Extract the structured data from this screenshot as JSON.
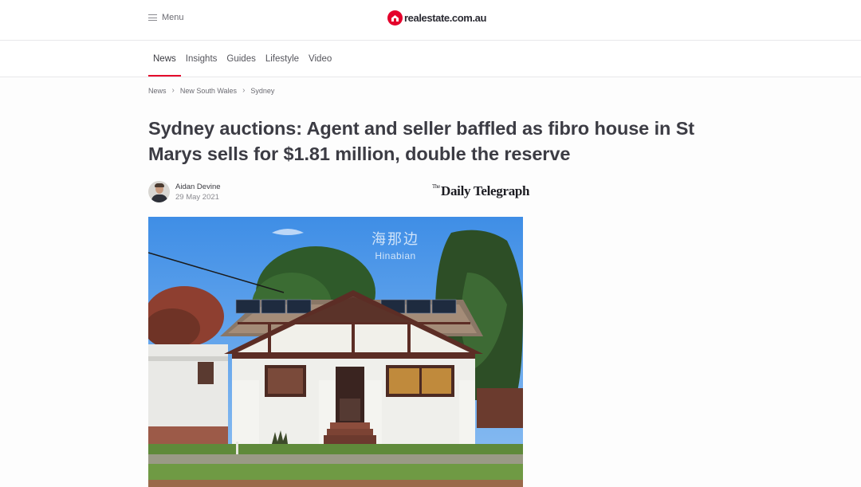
{
  "header": {
    "menu_label": "Menu",
    "logo_text": "realestate.com.au",
    "brand_color": "#e4002b"
  },
  "subnav": {
    "items": [
      {
        "label": "News",
        "active": true
      },
      {
        "label": "Insights",
        "active": false
      },
      {
        "label": "Guides",
        "active": false
      },
      {
        "label": "Lifestyle",
        "active": false
      },
      {
        "label": "Video",
        "active": false
      }
    ]
  },
  "breadcrumb": [
    "News",
    "New South Wales",
    "Sydney"
  ],
  "article": {
    "title": "Sydney auctions: Agent and seller baffled as fibro house in St Marys sells for $1.81 million, double the reserve",
    "author": "Aidan Devine",
    "date": "29 May 2021",
    "source_the": "The",
    "source": "Daily Telegraph"
  },
  "watermark": {
    "chinese": "海那边",
    "english": "Hinabian"
  },
  "icons": [
    "menu-icon",
    "realestate-logo-icon",
    "chevron-right-icon"
  ]
}
